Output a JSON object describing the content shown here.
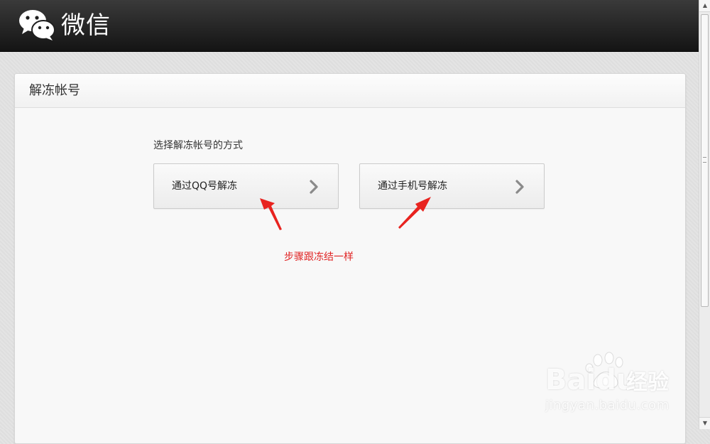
{
  "header": {
    "brand": "微信",
    "logo_icon": "wechat-logo-icon"
  },
  "panel": {
    "title": "解冻帐号",
    "section_label": "选择解冻帐号的方式",
    "options": [
      {
        "label": "通过QQ号解冻",
        "icon": "chevron-right-icon"
      },
      {
        "label": "通过手机号解冻",
        "icon": "chevron-right-icon"
      }
    ]
  },
  "annotation": {
    "text": "步骤跟冻结一样",
    "color": "#e02424"
  },
  "watermark": {
    "brand": "Bai",
    "brand_tail": "du",
    "suffix": "经验",
    "url": "jingyan.baidu.com"
  },
  "colors": {
    "topbar": "#1f1f1f",
    "annotation_red": "#e02424",
    "page_bg": "#e2e2e2"
  }
}
